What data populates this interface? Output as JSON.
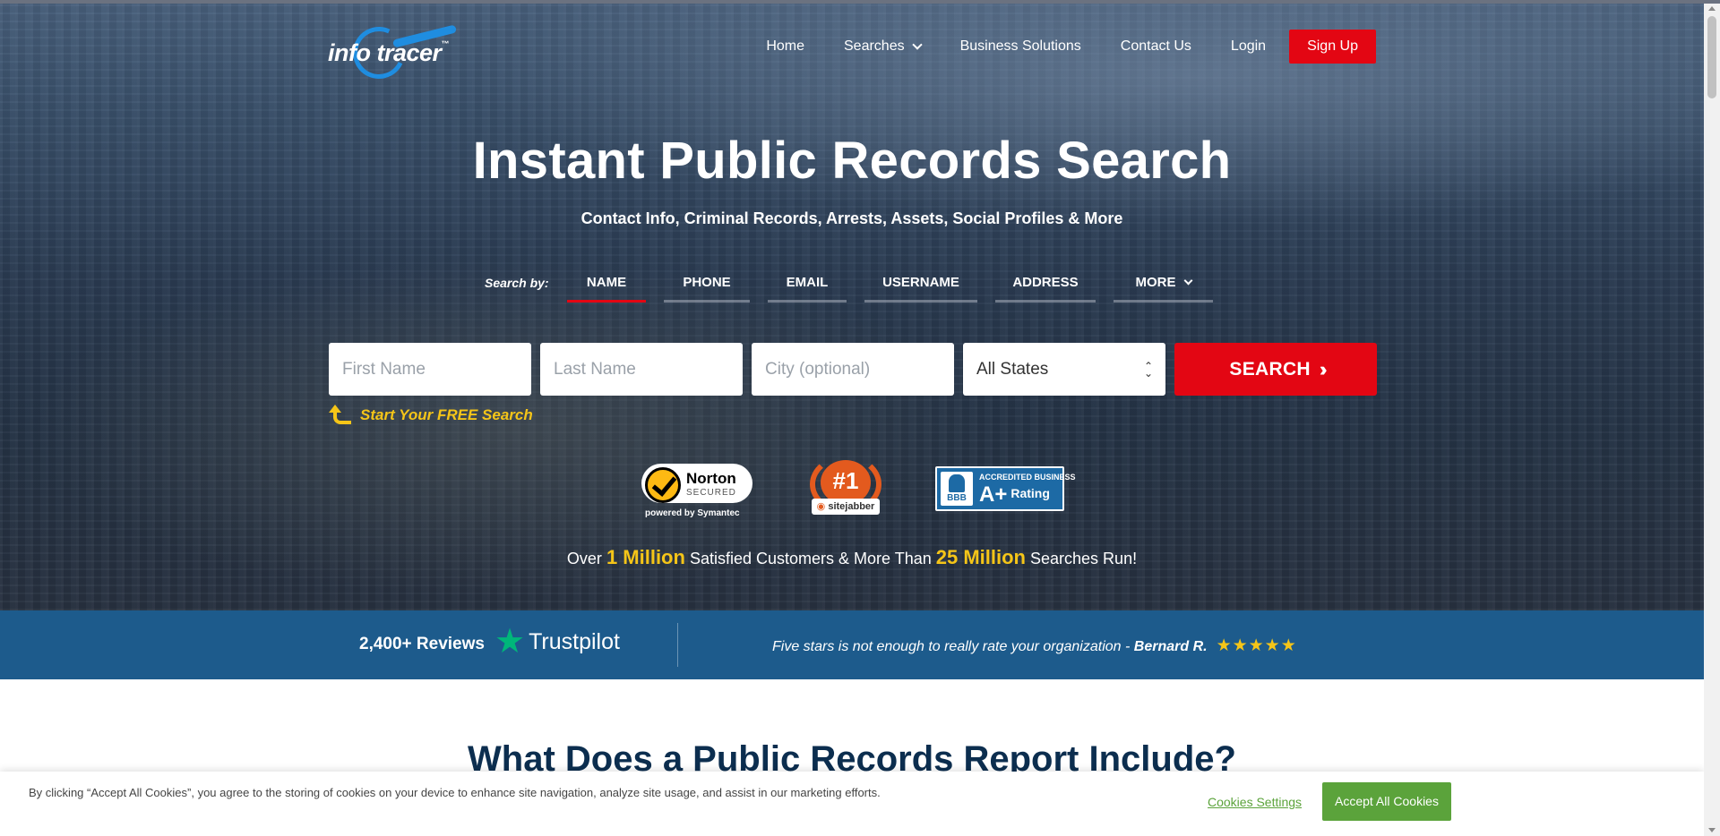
{
  "logo": {
    "text": "info tracer",
    "tm": "™"
  },
  "nav": {
    "home": "Home",
    "searches": "Searches",
    "business": "Business Solutions",
    "contact": "Contact Us",
    "login": "Login",
    "signup": "Sign Up"
  },
  "hero": {
    "title": "Instant Public Records Search",
    "subtitle": "Contact Info, Criminal Records, Arrests, Assets, Social Profiles & More"
  },
  "search": {
    "by_label": "Search by:",
    "tabs": [
      "NAME",
      "PHONE",
      "EMAIL",
      "USERNAME",
      "ADDRESS",
      "MORE"
    ],
    "active_tab": "NAME",
    "first_name_placeholder": "First Name",
    "last_name_placeholder": "Last Name",
    "city_placeholder": "City (optional)",
    "state_value": "All States",
    "button_label": "SEARCH",
    "free_label": "Start Your FREE Search"
  },
  "badges": {
    "norton_name": "Norton",
    "norton_secured": "SECURED",
    "norton_by": "powered by Symantec",
    "sitejabber_rank": "#1",
    "sitejabber_name": "sitejabber",
    "bbb_short": "BBB",
    "bbb_accredited": "ACCREDITED BUSINESS",
    "bbb_grade": "A+",
    "bbb_rating": "Rating"
  },
  "stats": {
    "over": "Over",
    "customers_count": "1 Million",
    "customers_text": "Satisfied Customers & More Than",
    "searches_count": "25 Million",
    "searches_text": "Searches Run!"
  },
  "trust": {
    "reviews": "2,400+ Reviews",
    "brand": "Trustpilot",
    "quote": "Five stars is not enough to really rate your organization -",
    "author": "Bernard R.",
    "stars": "★★★★★"
  },
  "section": {
    "heading": "What Does a Public Records Report Include?"
  },
  "cookie": {
    "text": "By clicking “Accept All Cookies”, you agree to the storing of cookies on your device to enhance site navigation, analyze site usage, and assist in our marketing efforts.",
    "settings": "Cookies Settings",
    "accept": "Accept All Cookies"
  },
  "colors": {
    "brand_red": "#e30613",
    "brand_blue": "#1f8de0",
    "trust_bar": "#1d5b8c",
    "highlight_yellow": "#f5c518",
    "cookie_green": "#5ba33b"
  }
}
